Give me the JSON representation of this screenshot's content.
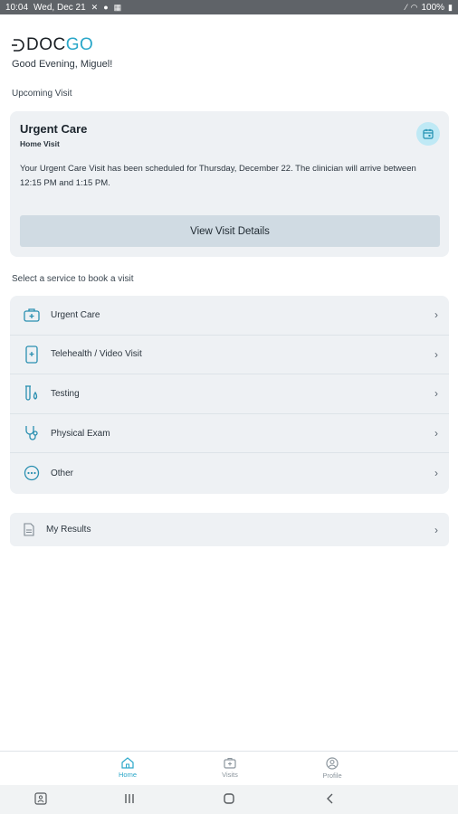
{
  "status_bar": {
    "time": "10:04",
    "date": "Wed, Dec 21",
    "battery": "100%"
  },
  "brand": {
    "logo_text_a": "DOC",
    "logo_text_b": "GO",
    "accent": "#2aa7c9"
  },
  "greeting": "Good Evening, Miguel!",
  "upcoming": {
    "section_label": "Upcoming Visit",
    "title": "Urgent Care",
    "subtitle": "Home Visit",
    "description": "Your Urgent Care Visit has been scheduled for Thursday, December 22. The clinician will arrive between 12:15 PM and 1:15 PM.",
    "details_button": "View Visit Details"
  },
  "services": {
    "section_label": "Select a service to book a visit",
    "items": [
      {
        "label": "Urgent Care",
        "icon": "first-aid-kit-icon"
      },
      {
        "label": "Telehealth / Video Visit",
        "icon": "tablet-icon"
      },
      {
        "label": "Testing",
        "icon": "test-tubes-icon"
      },
      {
        "label": "Physical Exam",
        "icon": "stethoscope-icon"
      },
      {
        "label": "Other",
        "icon": "more-icon"
      }
    ]
  },
  "results": {
    "label": "My Results",
    "icon": "document-icon"
  },
  "bottom_nav": {
    "items": [
      {
        "label": "Home",
        "icon": "home-icon",
        "active": true
      },
      {
        "label": "Visits",
        "icon": "visits-icon",
        "active": false
      },
      {
        "label": "Profile",
        "icon": "profile-icon",
        "active": false
      }
    ]
  }
}
